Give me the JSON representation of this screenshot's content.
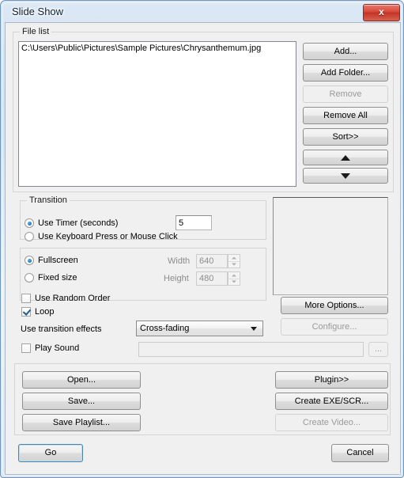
{
  "window": {
    "title": "Slide Show",
    "close_label": "✕"
  },
  "file_list": {
    "legend": "File list",
    "items": [
      "C:\\Users\\Public\\Pictures\\Sample Pictures\\Chrysanthemum.jpg"
    ],
    "buttons": {
      "add": "Add...",
      "add_folder": "Add Folder...",
      "remove": "Remove",
      "remove_all": "Remove All",
      "sort": "Sort>>",
      "move_up": "▲",
      "move_down": "▼"
    }
  },
  "transition": {
    "legend": "Transition",
    "use_timer_label": "Use Timer (seconds)",
    "use_keyboard_label": "Use Keyboard Press or Mouse Click",
    "timer_value": "5",
    "selected": "use_timer"
  },
  "size": {
    "fullscreen_label": "Fullscreen",
    "fixed_size_label": "Fixed size",
    "width_label": "Width",
    "height_label": "Height",
    "width_value": "640",
    "height_value": "480",
    "selected": "fullscreen"
  },
  "options": {
    "random_order_label": "Use Random Order",
    "random_order_checked": false,
    "loop_label": "Loop",
    "loop_checked": true,
    "transition_effects_label": "Use transition effects",
    "transition_effect_value": "Cross-fading",
    "play_sound_label": "Play Sound",
    "play_sound_checked": false,
    "sound_path_value": "",
    "browse_label": "...",
    "more_options": "More Options...",
    "configure": "Configure..."
  },
  "bottom": {
    "open": "Open...",
    "save": "Save...",
    "save_playlist": "Save Playlist...",
    "plugin": "Plugin>>",
    "create_exe": "Create EXE/SCR...",
    "create_video": "Create Video..."
  },
  "footer": {
    "go": "Go",
    "cancel": "Cancel"
  },
  "colors": {
    "accent": "#1d7fc4",
    "close_red": "#c03426",
    "dialog_bg": "#f0f0f0"
  }
}
